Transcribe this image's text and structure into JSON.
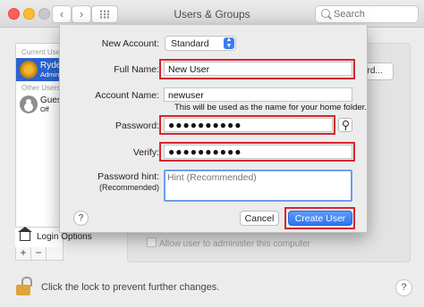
{
  "window": {
    "title": "Users & Groups",
    "search_placeholder": "Search",
    "nav_back": "‹",
    "nav_forward": "›"
  },
  "sidebar": {
    "current_user_header": "Current User",
    "current_user": {
      "name": "Ryder",
      "role": "Admin"
    },
    "other_users_header": "Other Users",
    "other_users": [
      {
        "name": "Guest",
        "status": "Off"
      }
    ],
    "login_options": "Login Options",
    "add": "+",
    "remove": "−"
  },
  "background": {
    "partial_button": "ord...",
    "admin_checkbox": "Allow user to administer this computer"
  },
  "bottom": {
    "lock_text": "Click the lock to prevent further changes.",
    "help": "?"
  },
  "sheet": {
    "new_account_label": "New Account:",
    "new_account_value": "Standard",
    "full_name_label": "Full Name:",
    "full_name_value": "New User",
    "account_name_label": "Account Name:",
    "account_name_value": "newuser",
    "account_name_note": "This will be used as the name for your home folder.",
    "password_label": "Password:",
    "password_value": "●●●●●●●●●●",
    "verify_label": "Verify:",
    "verify_value": "●●●●●●●●●●",
    "hint_label": "Password hint:",
    "hint_sublabel": "(Recommended)",
    "hint_placeholder": "Hint (Recommended)",
    "help": "?",
    "cancel": "Cancel",
    "create": "Create User"
  },
  "colors": {
    "highlight": "#d6252f",
    "accent": "#2f74ef",
    "selection": "#2a62cf"
  }
}
